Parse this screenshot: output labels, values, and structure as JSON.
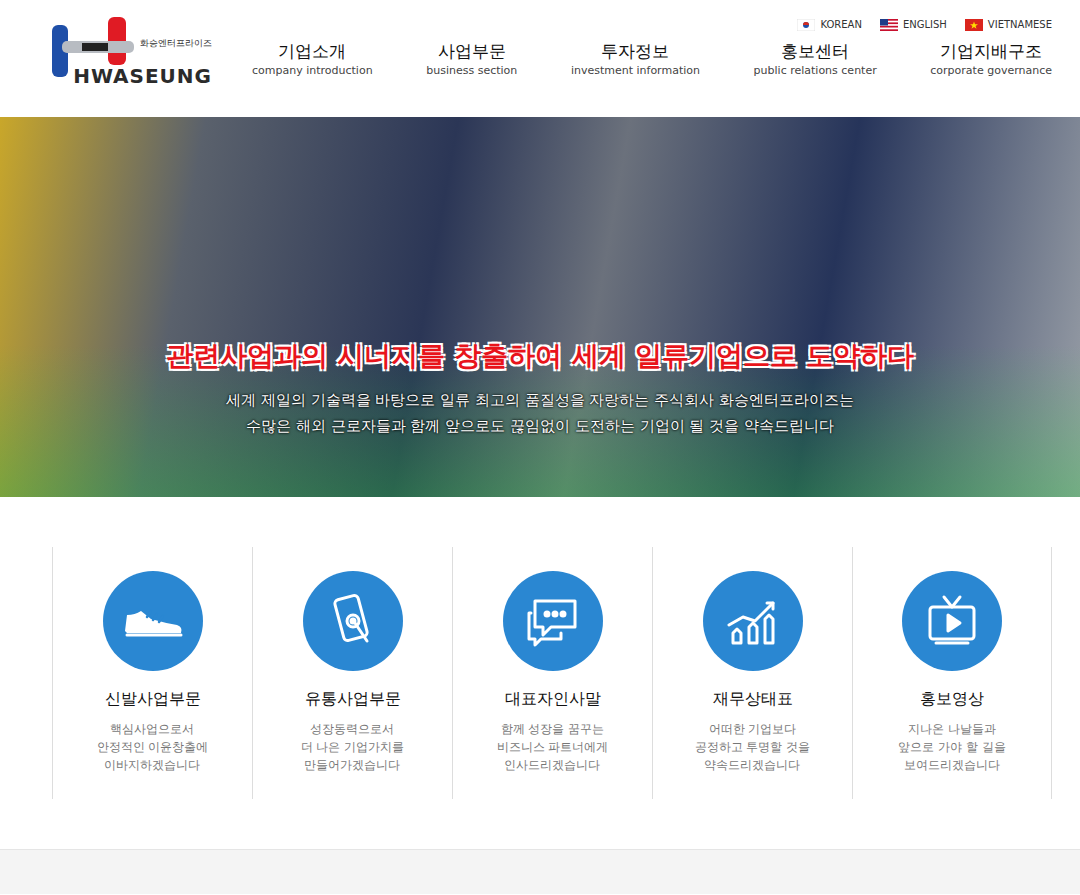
{
  "languages": [
    {
      "label": "KOREAN",
      "kind": "kr"
    },
    {
      "label": "ENGLISH",
      "kind": "us"
    },
    {
      "label": "VIETNAMESE",
      "kind": "vn"
    }
  ],
  "logo": {
    "korean": "화승엔터프라이즈",
    "english": "HWASEUNG"
  },
  "nav": [
    {
      "title": "기업소개",
      "subtitle": "company introduction"
    },
    {
      "title": "사업부문",
      "subtitle": "business section"
    },
    {
      "title": "투자정보",
      "subtitle": "investment information"
    },
    {
      "title": "홍보센터",
      "subtitle": "public relations center"
    },
    {
      "title": "기업지배구조",
      "subtitle": "corporate governance"
    }
  ],
  "hero": {
    "heading": "관련사업과의 시너지를 창출하여 세계 일류기업으로 도약하다",
    "lines": [
      "세계 제일의 기술력을 바탕으로 일류 최고의 품질성을 자랑하는 주식회사 화승엔터프라이즈는",
      "수많은 해외 근로자들과 함께 앞으로도 끊임없이 도전하는 기업이 될 것을 약속드립니다"
    ]
  },
  "cards": [
    {
      "kind": "shoe",
      "title": "신발사업부문",
      "lines": [
        "핵심사업으로서",
        "안정적인 이윤창출에",
        "이바지하겠습니다"
      ]
    },
    {
      "kind": "phone",
      "title": "유통사업부문",
      "lines": [
        "성장동력으로서",
        "더 나은 기업가치를",
        "만들어가겠습니다"
      ]
    },
    {
      "kind": "chat",
      "title": "대표자인사말",
      "lines": [
        "함께 성장을 꿈꾸는",
        "비즈니스 파트너에게",
        "인사드리겠습니다"
      ]
    },
    {
      "kind": "chart",
      "title": "재무상태표",
      "lines": [
        "어떠한 기업보다",
        "공정하고 투명할 것을",
        "약속드리겠습니다"
      ]
    },
    {
      "kind": "tv",
      "title": "홍보영상",
      "lines": [
        "지나온 나날들과",
        "앞으로 가야 할 길을",
        "보여드리겠습니다"
      ]
    }
  ]
}
